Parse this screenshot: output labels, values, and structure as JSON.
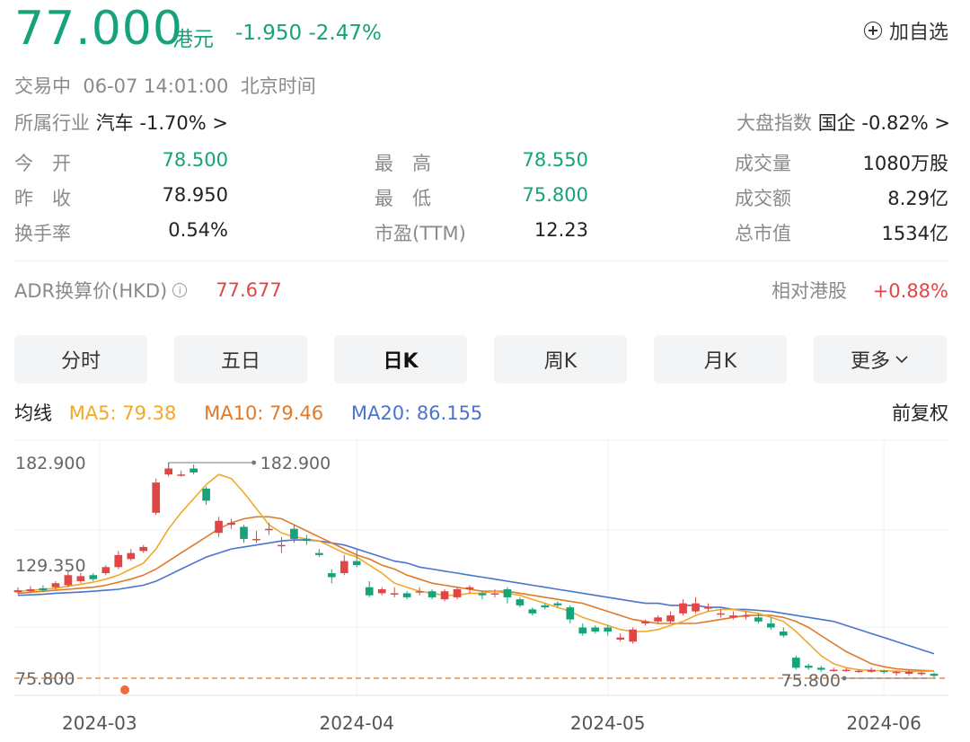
{
  "quote": {
    "price": "77.000",
    "currency": "港元",
    "change": "-1.950",
    "change_pct": "-2.47%",
    "add_watchlist": "加自选",
    "status": "交易中",
    "datetime": "06-07 14:01:00",
    "timezone": "北京时间",
    "industry_label": "所属行业",
    "industry_name": "汽车",
    "industry_change": "-1.70%",
    "index_label": "大盘指数",
    "index_name": "国企",
    "index_change": "-0.82%",
    "chevron": ">"
  },
  "stats": [
    {
      "label": "今　开",
      "value": "78.500",
      "color": "green"
    },
    {
      "label": "昨　收",
      "value": "78.950",
      "color": "black"
    },
    {
      "label": "换手率",
      "value": "0.54%",
      "color": "black"
    },
    {
      "label": "最　高",
      "value": "78.550",
      "color": "green"
    },
    {
      "label": "最　低",
      "value": "75.800",
      "color": "green"
    },
    {
      "label": "市盈(TTM)",
      "value": "12.23",
      "color": "black"
    },
    {
      "label": "成交量",
      "value": "1080万股",
      "color": "black"
    },
    {
      "label": "成交额",
      "value": "8.29亿",
      "color": "black"
    },
    {
      "label": "总市值",
      "value": "1534亿",
      "color": "black"
    }
  ],
  "adr": {
    "label": "ADR换算价(HKD)",
    "info_icon": "info-icon",
    "value": "77.677",
    "relative_label": "相对港股",
    "relative_value": "+0.88%"
  },
  "tabs": [
    "分时",
    "五日",
    "日K",
    "周K",
    "月K",
    "更多"
  ],
  "active_tab": "日K",
  "ma_legend": {
    "title": "均线",
    "ma5": "MA5: 79.38",
    "ma10": "MA10: 79.46",
    "ma20": "MA20: 86.155",
    "adjust": "前复权"
  },
  "colors": {
    "up": "#e04646",
    "down": "#16a27a",
    "ma5": "#f0a92a",
    "ma10": "#e07a2a",
    "ma20": "#4a74d0"
  },
  "chart_data": {
    "type": "candlestick",
    "y_labels": [
      "182.900",
      "129.350",
      "75.800"
    ],
    "max_marker": "182.900",
    "min_marker": "75.800",
    "x_ticks": [
      {
        "label": "2024-03",
        "index": 7
      },
      {
        "label": "2024-04",
        "index": 27
      },
      {
        "label": "2024-05",
        "index": 47
      },
      {
        "label": "2024-06",
        "index": 69
      }
    ],
    "ylim": [
      70,
      190
    ],
    "candles": [
      [
        118.5,
        119.5,
        121,
        117.5
      ],
      [
        119,
        120,
        121.5,
        118
      ],
      [
        120.5,
        119.5,
        122,
        118.5
      ],
      [
        121,
        123,
        124,
        120
      ],
      [
        122,
        127,
        129,
        121
      ],
      [
        124,
        126.5,
        128,
        123
      ],
      [
        127,
        125,
        128,
        124
      ],
      [
        128,
        131,
        132,
        127
      ],
      [
        131,
        137,
        139,
        130
      ],
      [
        135,
        138,
        140,
        134
      ],
      [
        139,
        141,
        142,
        138
      ],
      [
        158,
        173,
        175,
        157
      ],
      [
        177,
        180,
        183,
        176
      ],
      [
        177,
        177,
        179,
        176
      ],
      [
        180,
        178,
        182,
        177
      ],
      [
        170,
        164,
        171,
        162
      ],
      [
        148,
        154,
        156,
        146
      ],
      [
        152,
        153,
        155,
        150
      ],
      [
        151,
        145,
        152,
        143
      ],
      [
        145,
        145,
        149,
        143
      ],
      [
        150,
        150,
        153,
        147
      ],
      [
        142,
        142,
        146,
        138
      ],
      [
        150,
        145,
        152,
        143
      ],
      [
        145,
        144,
        147,
        142
      ],
      [
        138,
        137,
        140,
        136
      ],
      [
        128,
        126,
        130,
        123
      ],
      [
        128,
        134,
        137,
        127
      ],
      [
        134,
        132,
        140,
        131
      ],
      [
        121,
        117,
        124,
        116
      ],
      [
        118,
        120,
        121,
        117
      ],
      [
        118,
        118,
        121,
        116
      ],
      [
        118,
        116,
        119,
        115
      ],
      [
        119,
        119,
        121,
        117
      ],
      [
        119,
        116,
        120,
        115
      ],
      [
        115,
        119,
        120,
        114
      ],
      [
        116,
        120,
        121,
        115
      ],
      [
        120,
        121,
        122,
        118
      ],
      [
        118,
        117,
        119,
        115
      ],
      [
        118,
        118,
        120,
        116
      ],
      [
        120,
        116,
        121,
        113
      ],
      [
        115,
        112,
        116,
        111
      ],
      [
        110,
        108,
        111,
        107
      ],
      [
        112,
        111,
        113,
        110
      ],
      [
        113,
        112,
        114,
        111
      ],
      [
        111,
        105,
        112,
        103
      ],
      [
        101,
        98,
        103,
        97
      ],
      [
        101,
        99,
        102,
        98
      ],
      [
        101,
        99,
        102,
        97
      ],
      [
        95,
        96,
        98,
        94
      ],
      [
        94,
        100,
        101,
        93
      ],
      [
        103,
        104,
        105,
        102
      ],
      [
        104,
        106,
        107,
        103
      ],
      [
        104,
        107,
        109,
        103
      ],
      [
        108,
        113,
        115,
        107
      ],
      [
        109,
        113,
        116,
        108
      ],
      [
        111,
        111,
        113,
        109
      ],
      [
        108,
        108,
        110,
        106
      ],
      [
        106,
        107,
        109,
        105
      ],
      [
        107,
        107,
        109,
        105
      ],
      [
        106,
        104,
        108,
        103
      ],
      [
        103,
        101,
        106,
        100
      ],
      [
        99,
        97,
        101,
        96
      ],
      [
        86,
        81,
        87,
        80
      ],
      [
        82,
        81,
        83,
        80
      ],
      [
        81,
        80,
        82,
        79
      ],
      [
        80,
        80,
        81,
        79
      ],
      [
        80,
        80,
        81,
        79
      ],
      [
        79,
        79.5,
        80,
        78.5
      ],
      [
        79,
        80,
        81,
        78.5
      ],
      [
        79.5,
        79,
        80,
        78
      ],
      [
        78.5,
        79,
        79.5,
        77
      ],
      [
        78,
        79,
        80,
        77
      ],
      [
        78.5,
        78.5,
        79,
        77
      ],
      [
        78,
        77,
        78.6,
        75.8
      ]
    ],
    "ma5": [
      119,
      119.5,
      120,
      120.5,
      121.5,
      122.5,
      123.5,
      125,
      127,
      130,
      133,
      140,
      150,
      158,
      165,
      172,
      177,
      175,
      168,
      160,
      152,
      148,
      146,
      145,
      144,
      141,
      138,
      136,
      132,
      128,
      123,
      121,
      119,
      118,
      117,
      117,
      118,
      118,
      119,
      118,
      117,
      115,
      113,
      111,
      109,
      106,
      104,
      102,
      100,
      99,
      99,
      100,
      102,
      104,
      107,
      109,
      110,
      110,
      109,
      108,
      106,
      104,
      99,
      93,
      87,
      83,
      81,
      80,
      79.6,
      79.6,
      79.3,
      79.1,
      79.1,
      79.38
    ],
    "ma10": [
      118,
      118.5,
      119,
      119.5,
      120,
      120.5,
      121,
      122,
      123.5,
      125,
      127,
      130,
      134,
      138,
      142,
      146,
      150,
      153,
      155,
      156,
      156,
      155,
      152,
      149,
      146,
      143,
      140,
      137,
      135,
      132,
      130,
      127,
      125,
      123,
      122,
      121,
      120,
      119,
      119,
      119,
      118,
      117,
      116,
      115,
      114,
      113,
      111,
      109,
      107,
      105,
      104,
      103,
      103,
      103,
      103,
      104,
      105,
      106,
      107,
      107,
      107,
      106,
      104,
      101,
      97,
      93,
      89,
      86,
      83,
      81.5,
      80.5,
      80,
      79.7,
      79.46
    ],
    "ma20": [
      117,
      117.2,
      117.5,
      118,
      118.3,
      118.6,
      119,
      119.5,
      120,
      121,
      122,
      124,
      127,
      130,
      133,
      136,
      138,
      140,
      141,
      142,
      143,
      144,
      144.5,
      144.5,
      144,
      143,
      142,
      140,
      138,
      136,
      134,
      133,
      131,
      130,
      129,
      128,
      127,
      126,
      125,
      124,
      123,
      122,
      121,
      120,
      119,
      118,
      117,
      116,
      115,
      114,
      113,
      113,
      112,
      112,
      112,
      111,
      111,
      110,
      110,
      109.5,
      109,
      108,
      107,
      106,
      105,
      104,
      102,
      100,
      98,
      96,
      94,
      92,
      90,
      88
    ]
  }
}
